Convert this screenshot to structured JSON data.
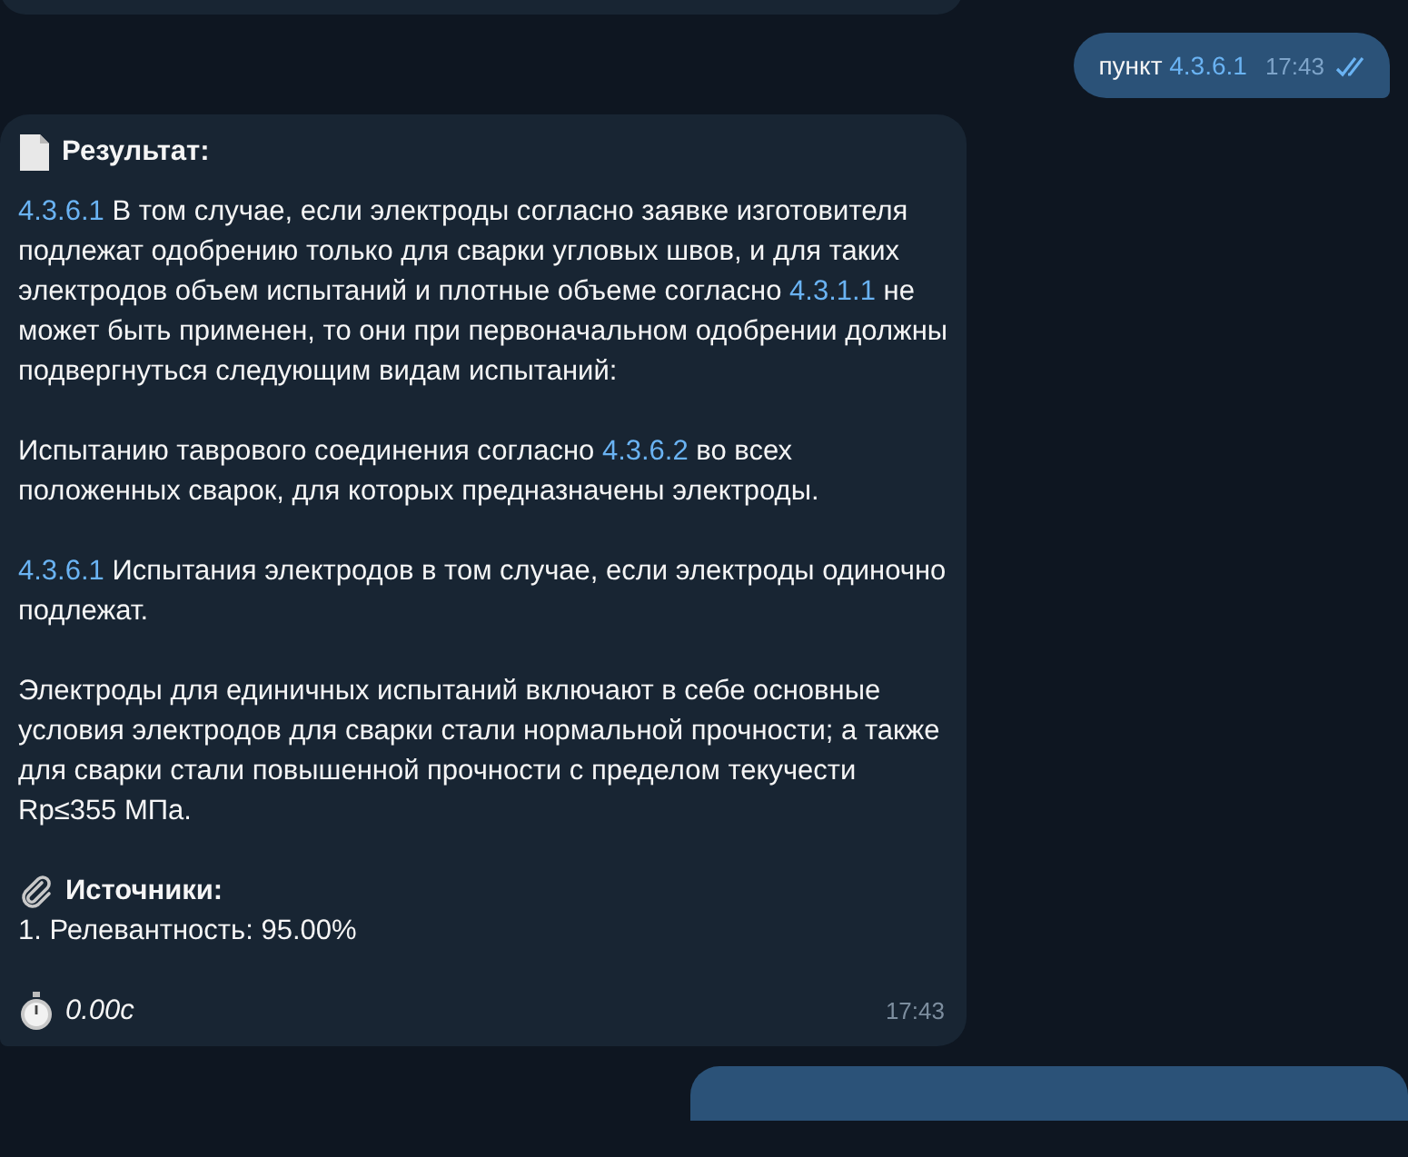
{
  "messages": [
    {
      "kind": "partial_incoming"
    },
    {
      "kind": "outgoing",
      "segments": [
        {
          "text": "пункт ",
          "link": false
        },
        {
          "text": "4.3.6.1",
          "link": true
        }
      ],
      "time": "17:43",
      "read": true
    },
    {
      "kind": "incoming",
      "title": "Результат:",
      "paragraphs": [
        [
          {
            "text": "4.3.6.1",
            "link": true
          },
          {
            "text": " В том случае, если электроды согласно заявке изготовителя подлежат одобрению только для сварки угловых швов, и для таких электродов объем испытаний и плотные объеме согласно ",
            "link": false
          },
          {
            "text": "4.3.1.1",
            "link": true
          },
          {
            "text": " не может быть применен, то они при первоначальном одобрении должны подвергнуться следующим видам испытаний:",
            "link": false
          }
        ],
        [
          {
            "text": "Испытанию таврового соединения согласно ",
            "link": false
          },
          {
            "text": "4.3.6.2",
            "link": true
          },
          {
            "text": " во всех положенных сварок, для которых предназначены электроды.",
            "link": false
          }
        ],
        [
          {
            "text": "4.3.6.1",
            "link": true
          },
          {
            "text": " Испытания электродов в том случае, если электроды одиночно подлежат.",
            "link": false
          }
        ],
        [
          {
            "text": "Электроды для единичных испытаний включают в себе основные условия электродов для сварки стали нормальной прочности; а также для сварки стали повышенной прочности с пределом текучести Rp≤355 МПа.",
            "link": false
          }
        ]
      ],
      "sources_title": "Источники:",
      "sources": [
        "1. Релевантность: 95.00%"
      ],
      "duration": "0.00с",
      "time": "17:43"
    },
    {
      "kind": "partial_outgoing"
    }
  ]
}
